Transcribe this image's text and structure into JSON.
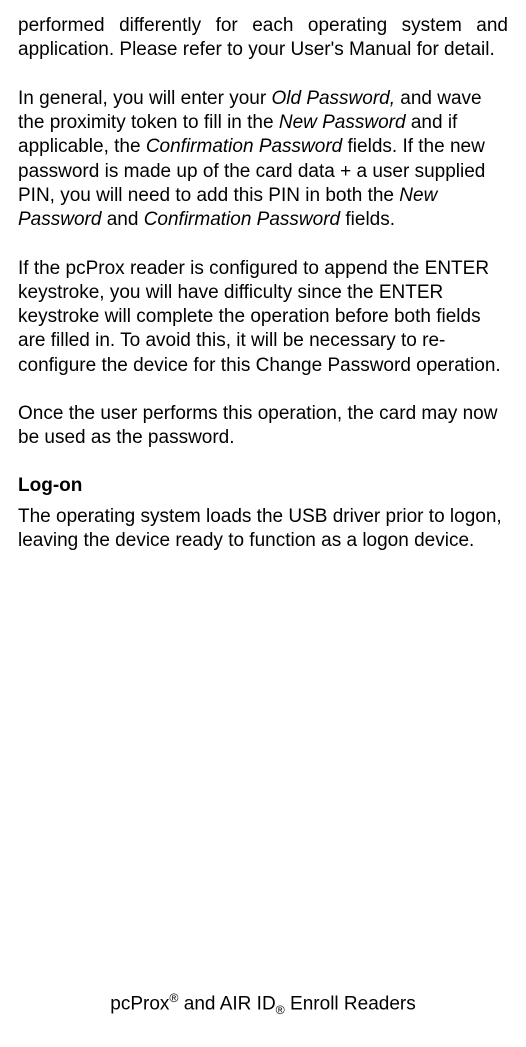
{
  "paragraphs": {
    "p1": "performed differently for each operating system and application. Please refer to your User's Manual for detail.",
    "p2_part1": "In general, you will enter your ",
    "p2_italic1": "Old Password,",
    "p2_part2": " and wave the proximity token to fill in the ",
    "p2_italic2": "New Password",
    "p2_part3": " and if applicable, the ",
    "p2_italic3": "Confirmation Password",
    "p2_part4": " fields. If the new password is made up of the card data + a user supplied PIN, you will need to add this PIN in both the ",
    "p2_italic4": "New Password",
    "p2_part5": " and ",
    "p2_italic5": "Confirmation Password",
    "p2_part6": " fields.",
    "p3": "If the pcProx reader is configured to append the ENTER keystroke, you will have difficulty since the ENTER keystroke will complete the operation before both fields are filled in. To avoid this, it will be necessary to re-configure the device for this Change Password operation.",
    "p4": "Once the user performs this operation, the card may now be used as the password.",
    "p5": "The operating system loads the USB driver prior to logon, leaving the device ready to function as a logon device."
  },
  "heading": "Log-on",
  "footer": {
    "part1": "pcProx",
    "sup1": "®",
    "part2": " and AIR ID",
    "sub1": "®",
    "part3": " Enroll Readers"
  }
}
